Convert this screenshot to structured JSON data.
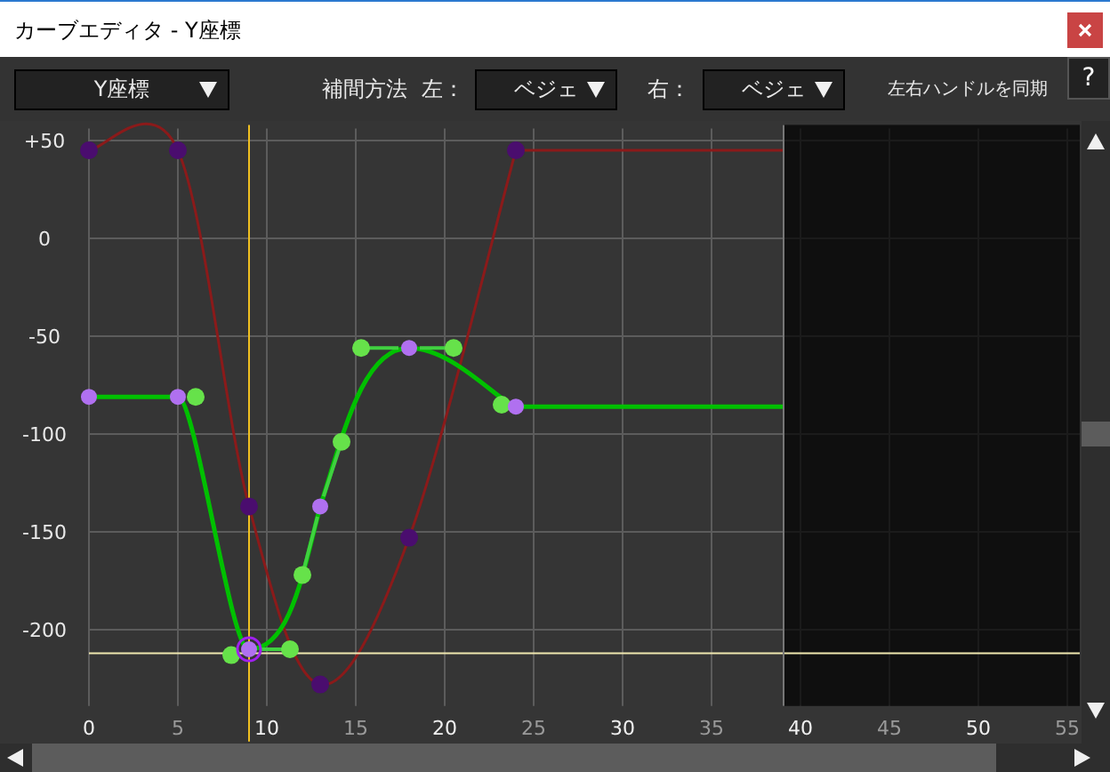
{
  "window": {
    "title": "カーブエディタ - Y座標"
  },
  "toolbar": {
    "property_dropdown": {
      "value": "Y座標"
    },
    "interpolation_label": "補間方法",
    "left_label": "左：",
    "left_dropdown": {
      "value": "ベジェ"
    },
    "right_label": "右：",
    "right_dropdown": {
      "value": "ベジェ"
    },
    "sync_handles_label": "左右ハンドルを同期",
    "help_button": "?"
  },
  "graph": {
    "chart_data": {
      "type": "line",
      "x": [
        0,
        5,
        9,
        13,
        18,
        24,
        39
      ],
      "series": [
        {
          "color": "#8b1a1a",
          "values": [
            45,
            45,
            -137,
            -228,
            -153,
            45,
            45
          ],
          "marker": true
        },
        {
          "color": "#00c000",
          "values": [
            -81,
            -81,
            -210,
            -137,
            -56,
            -86,
            -86
          ],
          "marker": true
        }
      ],
      "ref_lines": [
        {
          "axis": "x",
          "value": 9,
          "color": "#f0c020"
        },
        {
          "axis": "y",
          "value": -212,
          "color": "#f0e8b0"
        },
        {
          "axis": "x",
          "value": 39,
          "color": "#777777"
        }
      ],
      "xlim": [
        0,
        55.7
      ],
      "ylim": [
        -239,
        58
      ],
      "grid": true,
      "xticks": [
        0,
        5,
        10,
        15,
        20,
        25,
        30,
        35,
        40,
        45,
        50,
        55
      ],
      "yticks": [
        {
          "value": 50,
          "label": "+50"
        },
        {
          "value": 0,
          "label": "0"
        },
        {
          "value": -50,
          "label": "-50"
        },
        {
          "value": -100,
          "label": "-100"
        },
        {
          "value": -150,
          "label": "-150"
        },
        {
          "value": -200,
          "label": "-200"
        }
      ]
    }
  }
}
